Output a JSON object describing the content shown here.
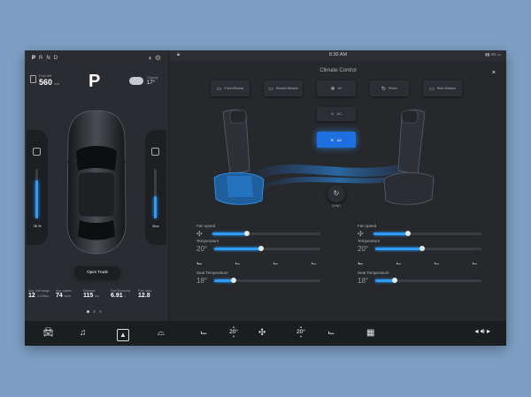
{
  "left_panel": {
    "gears": [
      "P",
      "R",
      "N",
      "D"
    ],
    "active_gear": "P",
    "fuel": {
      "label": "Fuel left",
      "value": "560",
      "unit": "km"
    },
    "park_indicator": "P",
    "weather": {
      "label": "Cloudy",
      "value": "17°"
    },
    "left_gauge": {
      "label": "76 %",
      "level": 0.76
    },
    "right_gauge": {
      "label": "Eco",
      "level": 0.45
    },
    "trunk_button": "Open Trunk",
    "stats": [
      {
        "label": "Avg. fuel usage",
        "value": "12",
        "unit": "L/100km"
      },
      {
        "label": "Avg. speed",
        "value": "74",
        "unit": "km/h"
      },
      {
        "label": "Distance",
        "value": "115",
        "unit": "km"
      },
      {
        "label": "Fuel Economy",
        "value": "6.91",
        "unit": "L"
      },
      {
        "label": "Fuel used",
        "value": "12.8",
        "unit": ""
      }
    ],
    "pager": {
      "count": 3,
      "active": 0
    }
  },
  "status_bar": {
    "time": "8:30 AM",
    "signal": "4G"
  },
  "climate": {
    "title": "Climate Control",
    "close": "×",
    "buttons": [
      {
        "label": "Front Window",
        "icon": "front-defrost-icon",
        "glyph": "▭"
      },
      {
        "label": "Electric Window",
        "icon": "window-icon",
        "glyph": "▭"
      },
      {
        "label": "AC",
        "icon": "snowflake-icon",
        "glyph": "❄"
      },
      {
        "label": "Recirc",
        "icon": "recirculate-icon",
        "glyph": "↻"
      },
      {
        "label": "Rear Window",
        "icon": "rear-defrost-icon",
        "glyph": "▭"
      }
    ],
    "ac_small": "AC",
    "ac_active": "AC",
    "sync": "SYNC",
    "left": {
      "fan_label": "Fan speed",
      "fan_level": 0.32,
      "temp_label": "Temperature",
      "temp_value": "20°",
      "temp_level": 0.44,
      "seat_temp_label": "Seat Temperature",
      "seat_temp_value": "18°",
      "seat_temp_level": 0.18
    },
    "right": {
      "fan_label": "Fan speed",
      "fan_level": 0.32,
      "temp_label": "Temperature",
      "temp_value": "20°",
      "temp_level": 0.44,
      "seat_temp_label": "Seat Temperature",
      "seat_temp_value": "18°",
      "seat_temp_level": 0.18
    }
  },
  "bottom_bar": {
    "left_temp": "20°",
    "right_temp": "20°",
    "icons": [
      "car-icon",
      "music-icon",
      "navigation-icon",
      "defrost-icon",
      "seat-icon",
      "fan-icon",
      "seat-icon",
      "rear-defrost-icon",
      "volume-icon"
    ]
  },
  "colors": {
    "accent": "#2d9cff",
    "background": "#232529",
    "page": "#7e9fc4"
  }
}
